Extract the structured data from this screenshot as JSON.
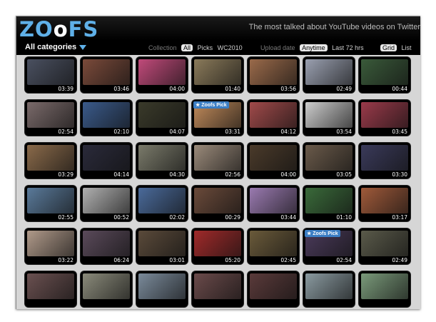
{
  "header": {
    "logo_main": "ZO",
    "logo_o": "o",
    "logo_end": "FS",
    "tagline": "The most talked about YouTube videos on Twitter"
  },
  "toolbar": {
    "category": "All categories",
    "collection_label": "Collection",
    "collection_options": [
      "All",
      "Picks",
      "WC2010"
    ],
    "collection_selected": "All",
    "upload_label": "Upload date",
    "upload_options": [
      "Anytime",
      "Last 72 hrs"
    ],
    "upload_selected": "Anytime",
    "view_options": [
      "Grid",
      "List"
    ],
    "view_selected": "Grid"
  },
  "pick_label": "Zoofs Pick",
  "videos": [
    {
      "duration": "03:39",
      "color": "#4a5060"
    },
    {
      "duration": "03:46",
      "color": "#7a4a3a"
    },
    {
      "duration": "04:00",
      "color": "#c04a7a"
    },
    {
      "duration": "01:40",
      "color": "#8a7a5a"
    },
    {
      "duration": "03:56",
      "color": "#9a6a4a"
    },
    {
      "duration": "02:49",
      "color": "#9aa0b0"
    },
    {
      "duration": "00:44",
      "color": "#3a5a3a"
    },
    {
      "duration": "02:54",
      "color": "#7a6a6a"
    },
    {
      "duration": "02:10",
      "color": "#3a5a8a"
    },
    {
      "duration": "04:07",
      "color": "#3a3a2a"
    },
    {
      "duration": "03:31",
      "color": "#c08a5a",
      "pick": true
    },
    {
      "duration": "04:12",
      "color": "#a04a4a"
    },
    {
      "duration": "03:54",
      "color": "#cccccc"
    },
    {
      "duration": "03:45",
      "color": "#9a3a4a"
    },
    {
      "duration": "03:29",
      "color": "#8a6a4a"
    },
    {
      "duration": "04:14",
      "color": "#2a2a3a"
    },
    {
      "duration": "04:30",
      "color": "#7a7a6a"
    },
    {
      "duration": "02:56",
      "color": "#9a8a7a"
    },
    {
      "duration": "04:00",
      "color": "#4a3a2a"
    },
    {
      "duration": "03:05",
      "color": "#6a5a4a"
    },
    {
      "duration": "03:30",
      "color": "#3a3a5a"
    },
    {
      "duration": "02:55",
      "color": "#5a7a9a"
    },
    {
      "duration": "00:52",
      "color": "#b0b0b0"
    },
    {
      "duration": "02:02",
      "color": "#4a6a9a"
    },
    {
      "duration": "00:29",
      "color": "#6a4a3a"
    },
    {
      "duration": "03:44",
      "color": "#9a7ab0"
    },
    {
      "duration": "01:10",
      "color": "#3a6a3a"
    },
    {
      "duration": "03:17",
      "color": "#a05a3a"
    },
    {
      "duration": "03:22",
      "color": "#b09a8a"
    },
    {
      "duration": "06:24",
      "color": "#5a4a5a"
    },
    {
      "duration": "03:01",
      "color": "#5a4a3a"
    },
    {
      "duration": "05:20",
      "color": "#a02a2a"
    },
    {
      "duration": "02:45",
      "color": "#6a5a3a"
    },
    {
      "duration": "02:54",
      "color": "#4a3a5a",
      "pick": true
    },
    {
      "duration": "02:49",
      "color": "#5a5a4a"
    },
    {
      "duration": "",
      "color": "#6a5050"
    },
    {
      "duration": "",
      "color": "#8a8a7a"
    },
    {
      "duration": "",
      "color": "#7a8a9a"
    },
    {
      "duration": "",
      "color": "#6a4a4a"
    },
    {
      "duration": "",
      "color": "#5a3a3a"
    },
    {
      "duration": "",
      "color": "#8a9aa0"
    },
    {
      "duration": "",
      "color": "#7a9a7a"
    }
  ]
}
